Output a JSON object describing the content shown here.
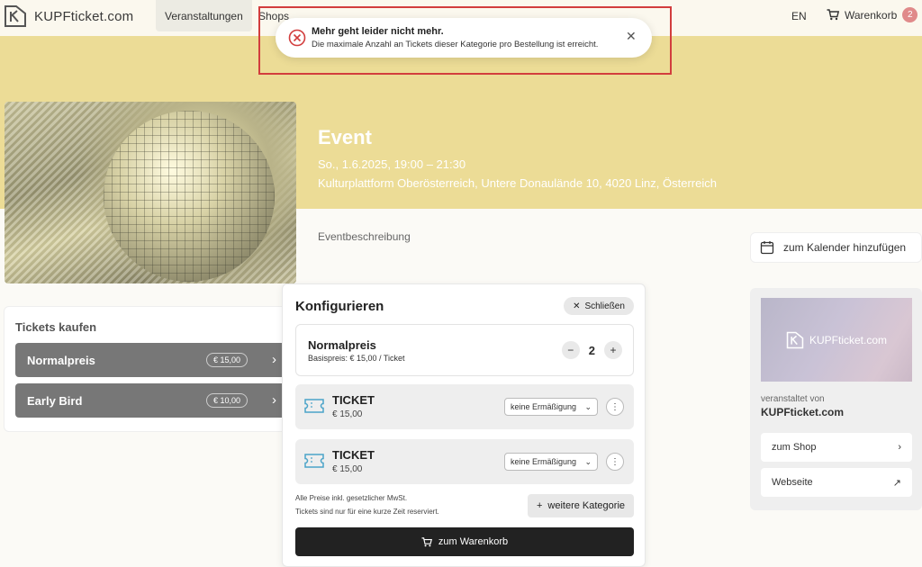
{
  "header": {
    "brand": "KUPFticket.com",
    "nav": [
      "Veranstaltungen",
      "Shops"
    ],
    "lang": "EN",
    "cart_label": "Warenkorb",
    "cart_count": "2"
  },
  "toast": {
    "title": "Mehr geht leider nicht mehr.",
    "message": "Die maximale Anzahl an Tickets dieser Kategorie pro Bestellung ist erreicht."
  },
  "event": {
    "title": "Event",
    "date": "So., 1.6.2025, 19:00 – 21:30",
    "location": "Kulturplattform Oberösterreich, Untere Donaulände 10, 4020 Linz, Österreich",
    "description_label": "Eventbeschreibung",
    "calendar_label": "zum Kalender hinzufügen"
  },
  "tickets": {
    "title": "Tickets kaufen",
    "categories": [
      {
        "name": "Normalpreis",
        "price": "€ 15,00"
      },
      {
        "name": "Early Bird",
        "price": "€ 10,00"
      }
    ]
  },
  "config": {
    "title": "Konfigurieren",
    "close_label": "Schließen",
    "category_name": "Normalpreis",
    "base_price": "Basispreis: € 15,00 / Ticket",
    "quantity": "2",
    "ticket_items": [
      {
        "name": "TICKET",
        "price": "€ 15,00",
        "discount": "keine Ermäßigung"
      },
      {
        "name": "TICKET",
        "price": "€ 15,00",
        "discount": "keine Ermäßigung"
      }
    ],
    "note_tax": "Alle Preise inkl. gesetzlicher MwSt.",
    "note_reserved": "Tickets sind nur für eine kurze Zeit reserviert.",
    "more_category": "weitere Kategorie",
    "to_cart": "zum Warenkorb"
  },
  "organizer": {
    "image_brand": "KUPFticket.com",
    "label": "veranstaltet von",
    "name": "KUPFticket.com",
    "shop_link": "zum Shop",
    "website_link": "Webseite"
  }
}
